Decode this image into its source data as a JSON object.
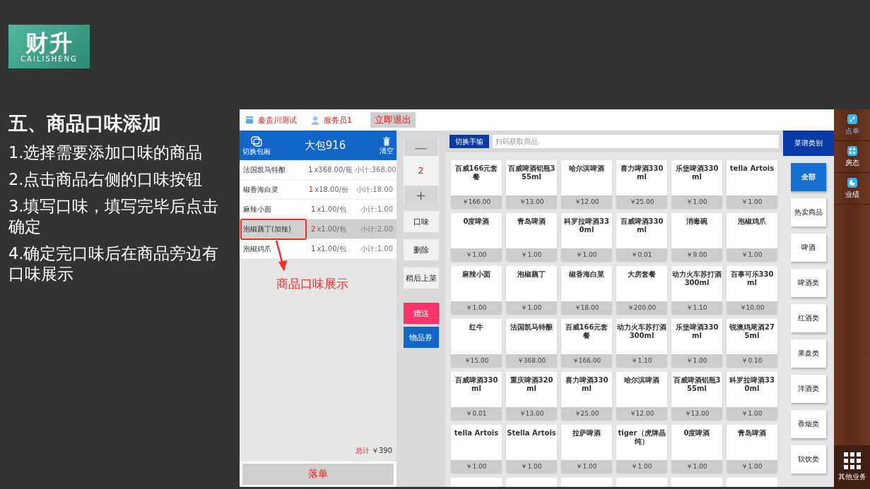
{
  "logo": {
    "mark": "财升",
    "subtitle": "CAILISHENG"
  },
  "heading": "五、商品口味添加",
  "steps": [
    "1.选择需要添加口味的商品",
    "2.点击商品右侧的口味按钮",
    "3.填写口味，填写完毕后点击确定",
    "4.确定完口味后在商品旁边有口味展示"
  ],
  "topbar": {
    "store": "秦贵川测试",
    "staff": "服务员1",
    "exit": "立即退出"
  },
  "order": {
    "switch_label": "切换包厢",
    "table": "大包916",
    "clear_label": "清空",
    "rows": [
      {
        "name": "法国凯马特酿",
        "qty": "1",
        "unit": "x368.00/瓶",
        "subtotal": "小计:368.00",
        "selected": false
      },
      {
        "name": "椒香海白菜",
        "qty": "1",
        "unit": "x18.00/份",
        "subtotal": "小计:18.00",
        "selected": false
      },
      {
        "name": "麻辣小面",
        "qty": "1",
        "unit": "x1.00/包",
        "subtotal": "小计:1.00",
        "selected": false
      },
      {
        "name": "泡椒藕丁(加辣)",
        "qty": "2",
        "unit": "x1.00/包",
        "subtotal": "小计:2.00",
        "selected": true
      },
      {
        "name": "泡椒鸡爪",
        "qty": "1",
        "unit": "x1.00/包",
        "subtotal": "小计:1.00",
        "selected": false
      }
    ],
    "total_label": "总计",
    "total": "￥390",
    "submit": "落单"
  },
  "annotation": {
    "text": "商品口味展示"
  },
  "controls": {
    "quantity": "2",
    "minus": "—",
    "plus": "+",
    "buttons": [
      {
        "label": "口味",
        "kind": "plain"
      },
      {
        "label": "删除",
        "kind": "plain"
      },
      {
        "label": "稍后上菜",
        "kind": "plain"
      },
      {
        "label": "赠送",
        "kind": "gift"
      },
      {
        "label": "物品券",
        "kind": "voucher"
      }
    ]
  },
  "search": {
    "switch": "切换手输",
    "placeholder": "扫码获取商品."
  },
  "products": [
    {
      "name": "百威166元套餐",
      "price": "￥166.00"
    },
    {
      "name": "百威啤酒铝瓶355ml",
      "price": "￥13.00"
    },
    {
      "name": "哈尔滨啤酒",
      "price": "￥12.00"
    },
    {
      "name": "喜力啤酒330ml",
      "price": "￥25.00"
    },
    {
      "name": "乐堡啤酒330ml",
      "price": "￥1.00"
    },
    {
      "name": "tella Artois",
      "price": "￥1.00"
    },
    {
      "name": "0度啤酒",
      "price": "￥1.00"
    },
    {
      "name": "青岛啤酒",
      "price": "￥1.00"
    },
    {
      "name": "科罗拉啤酒330ml",
      "price": "￥1.00"
    },
    {
      "name": "百威啤酒330ml",
      "price": "￥0.01"
    },
    {
      "name": "消毒碗",
      "price": "￥9.00"
    },
    {
      "name": "泡椒鸡爪",
      "price": "￥1.00"
    },
    {
      "name": "麻辣小面",
      "price": "￥1.00"
    },
    {
      "name": "泡椒藕丁",
      "price": "￥1.00"
    },
    {
      "name": "椒香海白菜",
      "price": "￥18.00"
    },
    {
      "name": "大房套餐",
      "price": "￥200.00"
    },
    {
      "name": "动力火车苏打酒300ml",
      "price": "￥1.10"
    },
    {
      "name": "百事可乐330ml",
      "price": "￥10.00"
    },
    {
      "name": "红牛",
      "price": "￥15.00"
    },
    {
      "name": "法国凯马特酿",
      "price": "￥368.00"
    },
    {
      "name": "百威166元套餐",
      "price": "￥166.00"
    },
    {
      "name": "动力火车苏打酒300ml",
      "price": "￥1.10"
    },
    {
      "name": "乐堡啤酒330ml",
      "price": "￥1.00"
    },
    {
      "name": "锐澳鸡尾酒275ml",
      "price": "￥0.10"
    },
    {
      "name": "百威啤酒330ml",
      "price": "￥0.01"
    },
    {
      "name": "重庆啤酒320ml",
      "price": "￥13.00"
    },
    {
      "name": "喜力啤酒330ml",
      "price": "￥25.00"
    },
    {
      "name": "哈尔滨啤酒",
      "price": "￥12.00"
    },
    {
      "name": "百威啤酒铝瓶355ml",
      "price": "￥13.00"
    },
    {
      "name": "科罗拉啤酒330ml",
      "price": "￥1.00"
    },
    {
      "name": "tella Artois",
      "price": "￥1.00"
    },
    {
      "name": "Stella Artois",
      "price": "￥1.00"
    },
    {
      "name": "拉萨啤酒",
      "price": "￥1.00"
    },
    {
      "name": "tiger（虎牌晶纯）",
      "price": "￥1.00"
    },
    {
      "name": "0度啤酒",
      "price": "￥1.00"
    },
    {
      "name": "青岛啤酒",
      "price": "￥1.00"
    }
  ],
  "categories": {
    "title": "菜谱类别",
    "items": [
      {
        "label": "全部",
        "selected": true
      },
      {
        "label": "热卖商品",
        "selected": false
      },
      {
        "label": "啤酒",
        "selected": false
      },
      {
        "label": "啤酒类",
        "selected": false
      },
      {
        "label": "红酒类",
        "selected": false
      },
      {
        "label": "果盘类",
        "selected": false
      },
      {
        "label": "洋酒类",
        "selected": false
      },
      {
        "label": "香烟类",
        "selected": false
      },
      {
        "label": "软饮类",
        "selected": false
      }
    ]
  },
  "nav": {
    "items": [
      {
        "label": "点单",
        "kind": "order",
        "selected": true
      },
      {
        "label": "房态",
        "kind": "rooms",
        "selected": false
      },
      {
        "label": "业绩",
        "kind": "stats",
        "selected": false
      }
    ],
    "more": "其他业务"
  }
}
